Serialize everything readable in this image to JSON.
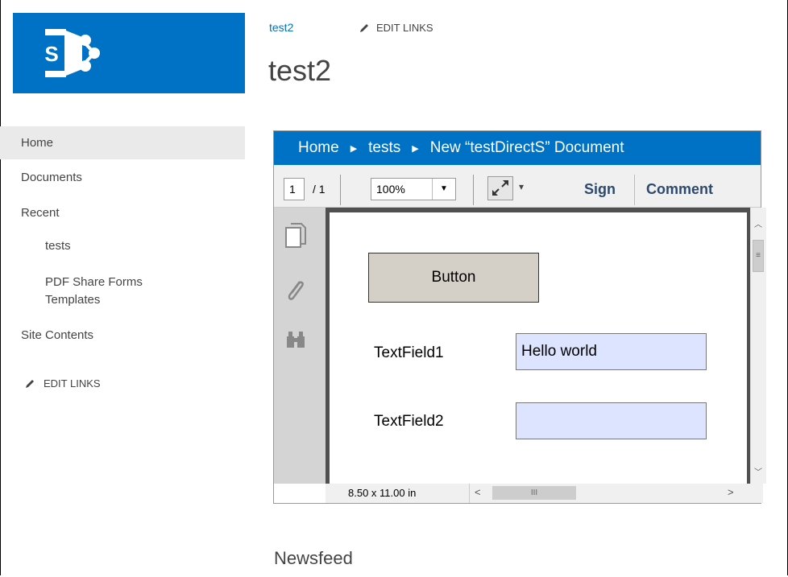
{
  "site": {
    "breadcrumb": "test2",
    "edit_links_top": "EDIT LINKS",
    "title": "test2"
  },
  "nav": {
    "home": "Home",
    "documents": "Documents",
    "recent": "Recent",
    "tests": "tests",
    "pdf_templates": "PDF Share Forms Templates",
    "site_contents": "Site Contents",
    "edit_links": "EDIT LINKS"
  },
  "viewer": {
    "breadcrumb": [
      "Home",
      "tests",
      "New “testDirectS” Document"
    ],
    "page_current": "1",
    "page_total": "/ 1",
    "zoom": "100%",
    "sign": "Sign",
    "comment": "Comment",
    "page_size": "8.50 x 11.00 in",
    "form": {
      "button_label": "Button",
      "field1_label": "TextField1",
      "field1_value": "Hello world",
      "field2_label": "TextField2",
      "field2_value": ""
    },
    "field_color": "#dde4ff",
    "accent": "#0072c6"
  },
  "newsfeed": "Newsfeed"
}
